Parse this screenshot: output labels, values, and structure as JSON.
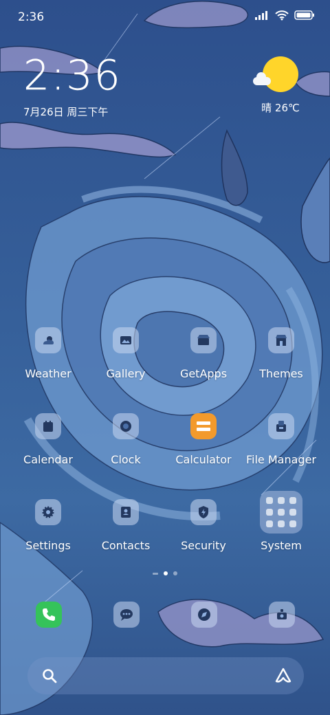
{
  "status_bar": {
    "time": "2:36",
    "icons": [
      "signal-icon",
      "wifi-icon",
      "battery-icon"
    ]
  },
  "clock_widget": {
    "time": "2:36",
    "date": "7月26日 周三下午"
  },
  "weather_widget": {
    "condition_temp": "晴 26℃",
    "icon": "sunny-icon"
  },
  "apps": [
    {
      "label": "Weather",
      "icon": "weather-icon"
    },
    {
      "label": "Gallery",
      "icon": "gallery-icon"
    },
    {
      "label": "GetApps",
      "icon": "getapps-icon"
    },
    {
      "label": "Themes",
      "icon": "themes-icon"
    },
    {
      "label": "Calendar",
      "icon": "calendar-icon"
    },
    {
      "label": "Clock",
      "icon": "clock-icon"
    },
    {
      "label": "Calculator",
      "icon": "calculator-icon"
    },
    {
      "label": "File Manager",
      "icon": "file-manager-icon"
    },
    {
      "label": "Settings",
      "icon": "settings-icon"
    },
    {
      "label": "Contacts",
      "icon": "contacts-icon"
    },
    {
      "label": "Security",
      "icon": "security-icon"
    },
    {
      "label": "System",
      "icon": "folder-icon"
    }
  ],
  "page_indicator": {
    "pages": 2,
    "current": 1
  },
  "dock": [
    {
      "name": "phone",
      "icon": "phone-icon"
    },
    {
      "name": "messaging",
      "icon": "message-icon"
    },
    {
      "name": "browser",
      "icon": "browser-icon"
    },
    {
      "name": "camera",
      "icon": "camera-icon"
    }
  ],
  "search": {
    "icon": "search-icon",
    "assistant_icon": "assistant-icon"
  },
  "colors": {
    "background": "#36609a",
    "sun": "#ffd52a",
    "phone_green": "#35c35a",
    "calculator_orange": "#f39a2c"
  }
}
